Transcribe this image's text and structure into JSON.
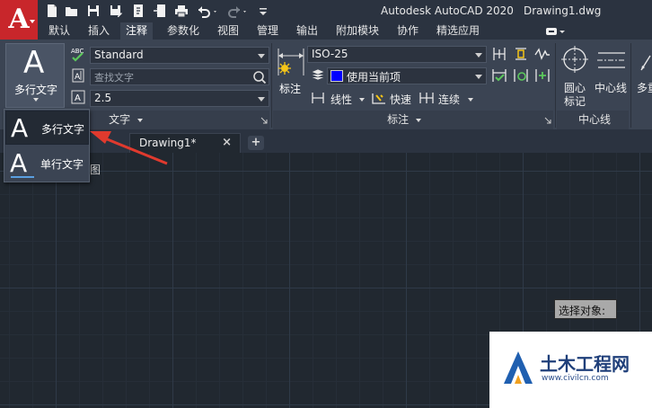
{
  "app": {
    "title": "Autodesk AutoCAD 2020",
    "document": "Drawing1.dwg",
    "logo_letter": "A",
    "brand_color": "#c8262b"
  },
  "quick_access": [
    "new-icon",
    "open-icon",
    "save-icon",
    "save-as-icon",
    "import-icon",
    "export-icon",
    "print-icon",
    "undo-icon",
    "redo-icon",
    "customize-icon"
  ],
  "ribbon_tabs": [
    "默认",
    "插入",
    "注释",
    "参数化",
    "视图",
    "管理",
    "输出",
    "附加模块",
    "协作",
    "精选应用"
  ],
  "active_tab": "注释",
  "text_panel": {
    "big_button_glyph": "A",
    "big_button_label": "多行文字",
    "style_value": "Standard",
    "find_placeholder": "查找文字",
    "height_value": "2.5",
    "panel_title": "文字"
  },
  "dim_panel": {
    "big_button_label": "标注",
    "dimstyle_value": "ISO-25",
    "layer_value": "使用当前项",
    "layer_swatch": "#0000ff",
    "linear_label": "线性",
    "quick_label": "快速",
    "continue_label": "连续",
    "panel_title": "标注"
  },
  "centerline_panel": {
    "center_mark_label_1": "圆心",
    "center_mark_label_2": "标记",
    "centerline_label": "中心线",
    "panel_title": "中心线"
  },
  "leader_panel": {
    "label": "多重"
  },
  "file_tab": {
    "name": "Drawing1*",
    "close": "×",
    "new": "+"
  },
  "text_menu": {
    "items": [
      {
        "glyph": "A",
        "label": "多行文字"
      },
      {
        "glyph": "A",
        "label": "单行文字"
      }
    ]
  },
  "drawing": {
    "partial_text": "图"
  },
  "tooltip": "选择对象:",
  "watermark": {
    "title": "土木工程网",
    "url": "www.civilcn.com"
  }
}
